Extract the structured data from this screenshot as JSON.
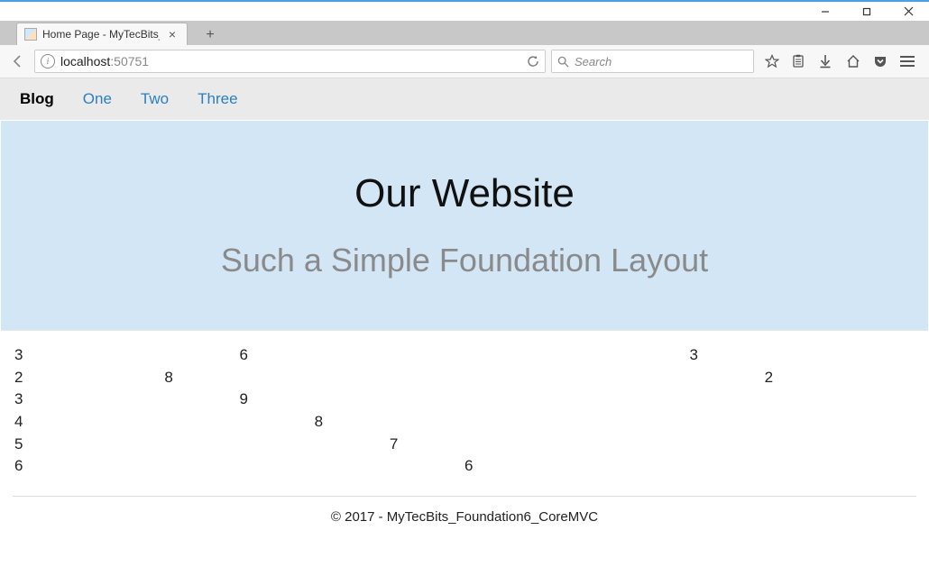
{
  "window": {
    "tab_title": "Home Page - MyTecBits_Fou"
  },
  "browser": {
    "url_host": "localhost",
    "url_port": ":50751",
    "search_placeholder": "Search"
  },
  "page_nav": {
    "brand": "Blog",
    "links": [
      "One",
      "Two",
      "Three"
    ]
  },
  "hero": {
    "title": "Our Website",
    "subtitle": "Such a Simple Foundation Layout"
  },
  "grid": {
    "rows": [
      [
        {
          "w": 3,
          "t": "3"
        },
        {
          "w": 6,
          "t": "6"
        },
        {
          "w": 3,
          "t": "3"
        }
      ],
      [
        {
          "w": 2,
          "t": "2"
        },
        {
          "w": 8,
          "t": "8"
        },
        {
          "w": 2,
          "t": "2"
        }
      ],
      [
        {
          "w": 3,
          "t": "3"
        },
        {
          "w": 9,
          "t": "9"
        }
      ],
      [
        {
          "w": 4,
          "t": "4"
        },
        {
          "w": 8,
          "t": "8"
        }
      ],
      [
        {
          "w": 5,
          "t": "5"
        },
        {
          "w": 7,
          "t": "7"
        }
      ],
      [
        {
          "w": 6,
          "t": "6"
        },
        {
          "w": 6,
          "t": "6"
        }
      ]
    ]
  },
  "footer": {
    "text": "© 2017 - MyTecBits_Foundation6_CoreMVC"
  }
}
